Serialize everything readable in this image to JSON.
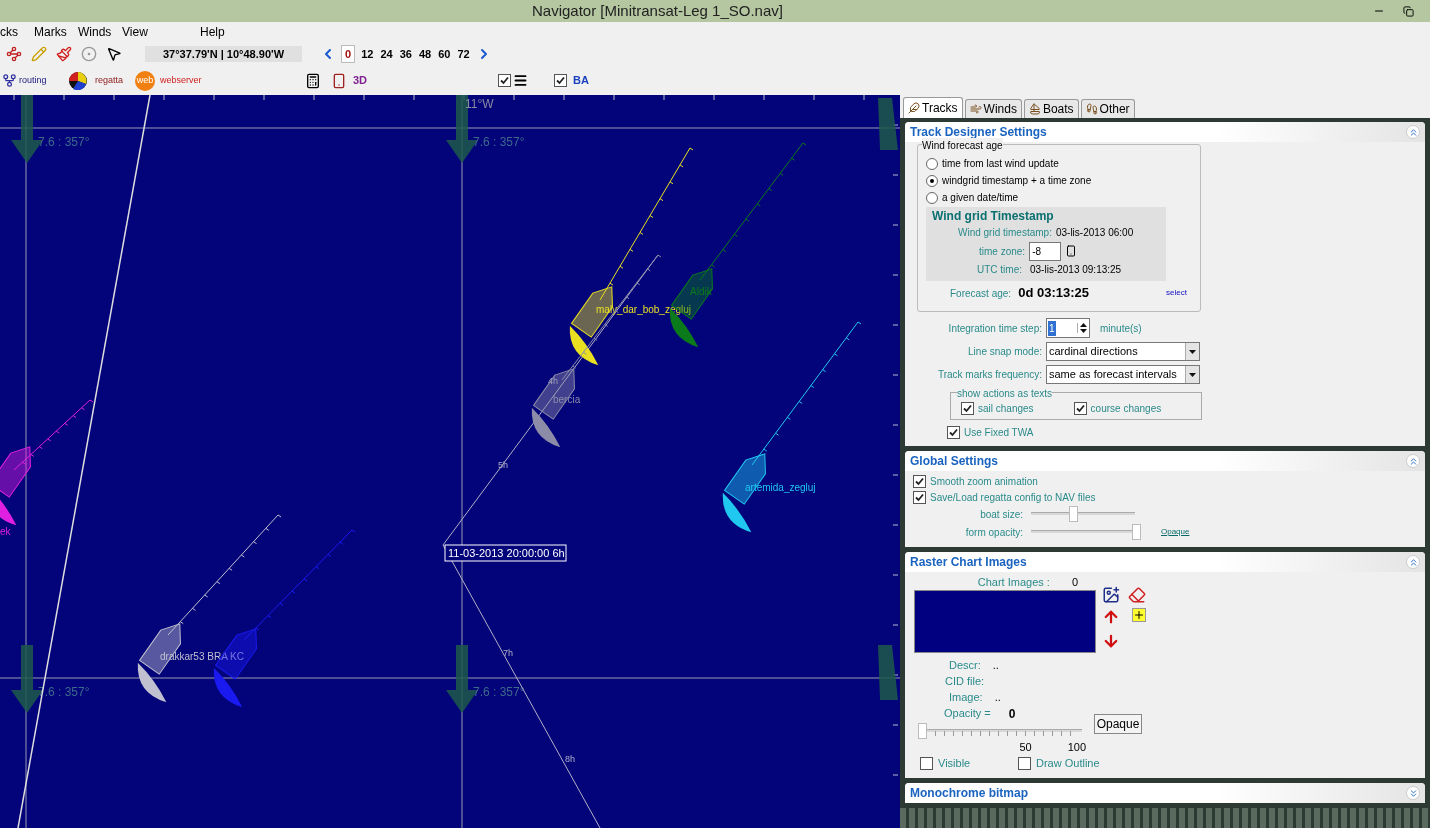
{
  "window": {
    "title": "Navigator [Minitransat-Leg 1_SO.nav]"
  },
  "menu": [
    "cks",
    "Marks",
    "Winds",
    "View",
    "Help"
  ],
  "coordinates": "37°37.79'N | 10°48.90'W",
  "time_steps": [
    {
      "label": "0",
      "selected": true
    },
    {
      "label": "12",
      "selected": false
    },
    {
      "label": "24",
      "selected": false
    },
    {
      "label": "36",
      "selected": false
    },
    {
      "label": "48",
      "selected": false
    },
    {
      "label": "60",
      "selected": false
    },
    {
      "label": "72",
      "selected": false
    }
  ],
  "toolbar": {
    "routing": "routing",
    "regatta": "regatta",
    "web_logo": "web",
    "webserver": "webserver",
    "view_3d": "3D",
    "layers_checked": true,
    "ba_checked": true,
    "ba": "BA"
  },
  "map": {
    "meridian_label": "11°W",
    "wind_labels": [
      "7.6 : 357°",
      "7.6 : 357°",
      "7.6 : 357°",
      "7.6 : 357°"
    ],
    "boats": [
      {
        "name": "maly_dar_bob_zegluj",
        "color": "#e8e020"
      },
      {
        "name": "Aldik",
        "color": "#0a7a1a"
      },
      {
        "name": "bercia",
        "color": "#8c8ca8"
      },
      {
        "name": "artemida_zegluj",
        "color": "#20c8f0"
      },
      {
        "name": "drakkar53 BRA KC",
        "color": "#c0c0d0"
      },
      {
        "color": "#1a1af0"
      },
      {
        "name": "ek",
        "color": "#e020e0"
      }
    ],
    "time_marks": [
      "4h",
      "5h",
      "7h",
      "8h"
    ],
    "tooltip": "11-03-2013 20:00:00 6h"
  },
  "tabs": [
    {
      "label": "Tracks",
      "selected": true
    },
    {
      "label": "Winds",
      "selected": false
    },
    {
      "label": "Boats",
      "selected": false
    },
    {
      "label": "Other",
      "selected": false
    }
  ],
  "track_designer": {
    "title": "Track Designer Settings",
    "expanded": true,
    "group_title": "Wind forecast age",
    "radios": [
      {
        "label": "time from last wind update",
        "selected": false
      },
      {
        "label": "windgrid timestamp + a time zone",
        "selected": true
      },
      {
        "label": "a given date/time",
        "selected": false
      }
    ],
    "timestamp_title": "Wind grid Timestamp",
    "grid_timestamp_label": "Wind grid timestamp:",
    "grid_timestamp": "03-lis-2013 06:00",
    "time_zone_label": "time zone:",
    "time_zone": "-8",
    "utc_label": "UTC time:",
    "utc": "03-lis-2013 09:13:25",
    "forecast_age_label": "Forecast age:",
    "forecast_age": "0d 03:13:25",
    "select_link": "select",
    "step_label": "Integration time step:",
    "step": "1",
    "step_unit": "minute(s)",
    "snap_label": "Line snap mode:",
    "snap": "cardinal directions",
    "marks_label": "Track marks frequency:",
    "marks": "same as forecast intervals",
    "actions_title": "show actions as texts",
    "actions": [
      {
        "label": "sail changes",
        "checked": true
      },
      {
        "label": "course changes",
        "checked": true
      }
    ],
    "fixed_twa": {
      "label": "Use Fixed TWA",
      "checked": true
    }
  },
  "global_settings": {
    "title": "Global Settings",
    "expanded": true,
    "options": [
      {
        "label": "Smooth zoom animation",
        "checked": true
      },
      {
        "label": "Save/Load regatta config to NAV files",
        "checked": true
      }
    ],
    "boat_size_label": "boat size:",
    "boat_size": {
      "level": 0.4
    },
    "opacity_label": "form opacity:",
    "opacity": {
      "level": 1.0
    },
    "opaque_link": "Opaque"
  },
  "raster_chart": {
    "title": "Raster Chart Images",
    "expanded": true,
    "count_label": "Chart Images :",
    "count": "0",
    "descr_label": "Descr:",
    "descr": "..",
    "cid_label": "CID file:",
    "image_label": "Image:",
    "image": "..",
    "opacity_label": "Opacity =",
    "opacity_value": "0",
    "opacity": {
      "level": 0
    },
    "opaque_button": "Opaque",
    "scale_mid": "50",
    "scale_max": "100",
    "visible": {
      "label": "Visible",
      "checked": false
    },
    "outline": {
      "label": "Draw Outline",
      "checked": false
    }
  },
  "monochrome": {
    "title": "Monochrome bitmap",
    "expanded": false
  }
}
